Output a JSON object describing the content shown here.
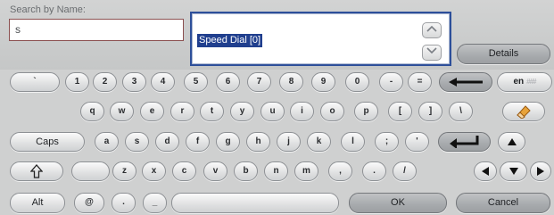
{
  "search": {
    "label": "Search by Name:",
    "value": "s"
  },
  "list": {
    "selected_item": "Speed Dial [0]"
  },
  "buttons": {
    "details": "Details",
    "ok": "OK",
    "cancel": "Cancel"
  },
  "keyboard": {
    "row1": [
      "`",
      "1",
      "2",
      "3",
      "4",
      "5",
      "6",
      "7",
      "8",
      "9",
      "0",
      "-",
      "="
    ],
    "lang": {
      "label": "en",
      "sub": "###"
    },
    "row2": [
      "q",
      "w",
      "e",
      "r",
      "t",
      "y",
      "u",
      "i",
      "o",
      "p",
      "[",
      "]",
      "\\"
    ],
    "caps": "Caps",
    "row3": [
      "a",
      "s",
      "d",
      "f",
      "g",
      "h",
      "j",
      "k",
      "l",
      ";",
      "'"
    ],
    "row4": [
      "z",
      "x",
      "c",
      "v",
      "b",
      "n",
      "m",
      ",",
      ".",
      "/"
    ],
    "alt": "Alt",
    "row5": [
      "@",
      ".",
      "_"
    ]
  },
  "icons": {
    "scroll_up": "chevron-up-icon",
    "scroll_down": "chevron-down-icon",
    "backspace": "arrow-left-icon",
    "clear": "eraser-icon",
    "enter": "enter-icon",
    "shift": "shift-icon",
    "up": "triangle-up-icon",
    "down": "triangle-down-icon",
    "left": "triangle-left-icon",
    "right": "triangle-right-icon"
  },
  "colors": {
    "selection": "#203f8e",
    "list_border": "#2d4f9a",
    "eraser": "#e8a33a"
  }
}
